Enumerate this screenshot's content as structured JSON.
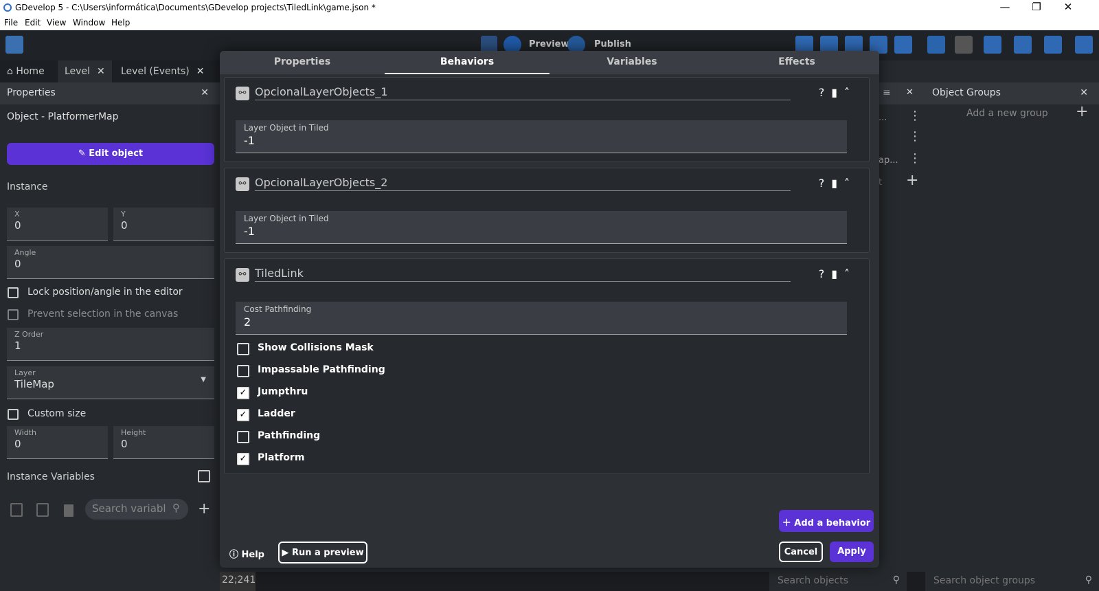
{
  "window": {
    "title": "GDevelop 5 - C:\\Users\\informática\\Documents\\GDevelop projects\\TiledLink\\game.json *",
    "minimize": "—",
    "maximize": "❐",
    "close": "✕"
  },
  "menu": [
    "File",
    "Edit",
    "View",
    "Window",
    "Help"
  ],
  "toolbar": {
    "preview": "Preview",
    "publish": "Publish"
  },
  "tabs": [
    {
      "label": "Home"
    },
    {
      "label": "Level"
    },
    {
      "label": "Level (Events)"
    }
  ],
  "properties_panel": {
    "title": "Properties",
    "object_line": "Object  - PlatformerMap",
    "edit_object": "Edit object",
    "instance_header": "Instance",
    "x": {
      "label": "X",
      "value": "0"
    },
    "y": {
      "label": "Y",
      "value": "0"
    },
    "angle": {
      "label": "Angle",
      "value": "0"
    },
    "lock_label": "Lock position/angle in the editor",
    "prevent_label": "Prevent selection in the canvas",
    "z_order": {
      "label": "Z Order",
      "value": "1"
    },
    "layer": {
      "label": "Layer",
      "value": "TileMap"
    },
    "custom_size": "Custom size",
    "width": {
      "label": "Width",
      "value": "0"
    },
    "height": {
      "label": "Height",
      "value": "0"
    },
    "instance_variables": "Instance Variables",
    "search_placeholder": "Search variabl"
  },
  "object_groups": {
    "title": "Object Groups",
    "add_group": "Add a new group",
    "search_placeholder": "Search object groups"
  },
  "objects_panel": {
    "search_placeholder": "Search objects",
    "frag1": "...",
    "frag2": "ap...",
    "frag3": "t"
  },
  "canvas": {
    "coords": "22;241"
  },
  "dialog": {
    "tabs": [
      "Properties",
      "Behaviors",
      "Variables",
      "Effects"
    ],
    "active_tab": "Behaviors",
    "behaviors": [
      {
        "name": "OpcionalLayerObjects_1",
        "field_label": "Layer Object in Tiled",
        "field_value": "-1"
      },
      {
        "name": "OpcionalLayerObjects_2",
        "field_label": "Layer Object in Tiled",
        "field_value": "-1"
      },
      {
        "name": "TiledLink",
        "field_label": "Cost Pathfinding",
        "field_value": "2",
        "checkboxes": [
          {
            "label": "Show Collisions Mask",
            "checked": false
          },
          {
            "label": "Impassable Pathfinding",
            "checked": false
          },
          {
            "label": "Jumpthru",
            "checked": true
          },
          {
            "label": "Ladder",
            "checked": true
          },
          {
            "label": "Pathfinding",
            "checked": false
          },
          {
            "label": "Platform",
            "checked": true
          }
        ]
      }
    ],
    "add_behavior": "Add a behavior",
    "help": "Help",
    "run_preview": "Run a preview",
    "cancel": "Cancel",
    "apply": "Apply"
  },
  "colors": {
    "accent": "#5a32d6",
    "background": "#26292d",
    "panel": "#33373c"
  }
}
